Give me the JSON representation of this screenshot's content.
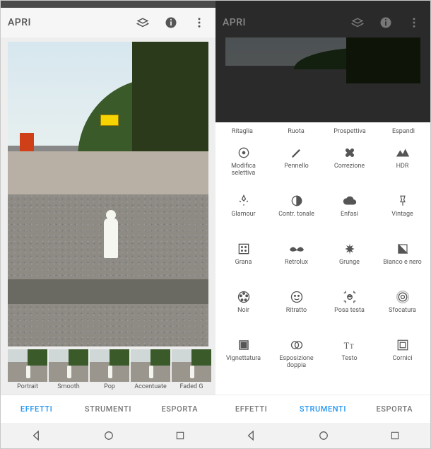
{
  "left": {
    "topbar": {
      "title": "APRI"
    },
    "effects": [
      {
        "label": "Portrait"
      },
      {
        "label": "Smooth"
      },
      {
        "label": "Pop"
      },
      {
        "label": "Accentuate"
      },
      {
        "label": "Faded G"
      }
    ],
    "tabs": {
      "effetti": "EFFETTI",
      "strumenti": "STRUMENTI",
      "esporta": "ESPORTA",
      "active": "effetti"
    }
  },
  "right": {
    "topbar": {
      "title": "APRI"
    },
    "top_row": [
      "Ritaglia",
      "Ruota",
      "Prospettiva",
      "Espandi"
    ],
    "tools": [
      {
        "label": "Modifica selettiva",
        "icon": "target"
      },
      {
        "label": "Pennello",
        "icon": "brush"
      },
      {
        "label": "Correzione",
        "icon": "bandage"
      },
      {
        "label": "HDR",
        "icon": "hdr"
      },
      {
        "label": "Glamour",
        "icon": "glamour"
      },
      {
        "label": "Contr. tonale",
        "icon": "tonal"
      },
      {
        "label": "Enfasi",
        "icon": "cloud"
      },
      {
        "label": "Vintage",
        "icon": "pin"
      },
      {
        "label": "Grana",
        "icon": "grain"
      },
      {
        "label": "Retrolux",
        "icon": "mustache"
      },
      {
        "label": "Grunge",
        "icon": "grunge"
      },
      {
        "label": "Bianco e nero",
        "icon": "bw"
      },
      {
        "label": "Noir",
        "icon": "reel"
      },
      {
        "label": "Ritratto",
        "icon": "face"
      },
      {
        "label": "Posa testa",
        "icon": "headpose"
      },
      {
        "label": "Sfocatura",
        "icon": "blur"
      },
      {
        "label": "Vignettatura",
        "icon": "vignette"
      },
      {
        "label": "Esposizione doppia",
        "icon": "double"
      },
      {
        "label": "Testo",
        "icon": "text"
      },
      {
        "label": "Cornici",
        "icon": "frame"
      }
    ],
    "tabs": {
      "effetti": "EFFETTI",
      "strumenti": "STRUMENTI",
      "esporta": "ESPORTA",
      "active": "strumenti"
    }
  },
  "colors": {
    "accent": "#2196f3"
  }
}
